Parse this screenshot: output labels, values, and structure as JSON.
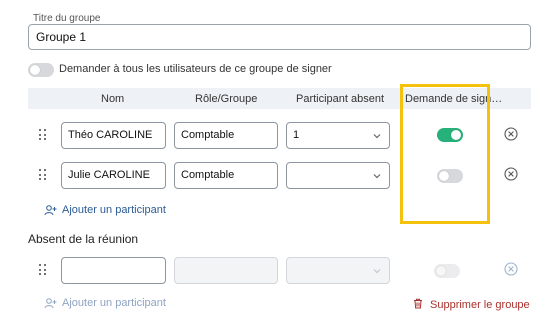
{
  "group": {
    "title_label": "Titre du groupe",
    "title_value": "Groupe 1"
  },
  "ask_all": {
    "label": "Demander à tous les utilisateurs de ce groupe de signer",
    "enabled": false
  },
  "table": {
    "headers": [
      "Nom",
      "Rôle/Groupe",
      "Participant absent",
      "Demande de sign…"
    ],
    "rows": [
      {
        "name": "Théo CAROLINE",
        "role": "Comptable",
        "absent_participant": "1",
        "sign_request": true
      },
      {
        "name": "Julie CAROLINE",
        "role": "Comptable",
        "absent_participant": "",
        "sign_request": false
      }
    ]
  },
  "add_participant_label": "Ajouter un participant",
  "absent_section": {
    "heading": "Absent de la réunion",
    "row": {
      "name": "",
      "role": "",
      "absent_participant": "",
      "sign_request": false
    },
    "add_participant_label": "Ajouter un participant"
  },
  "delete_group_label": "Supprimer le groupe",
  "colors": {
    "toggle_on": "#26b07a",
    "highlight": "#f4c20d",
    "link": "#2b5b96",
    "danger": "#a8322c"
  },
  "icons": {
    "drag": "drag-handle-icon",
    "chevron": "chevron-down-icon",
    "remove": "remove-circle-x-icon",
    "add_user": "add-user-icon",
    "trash": "trash-icon"
  }
}
